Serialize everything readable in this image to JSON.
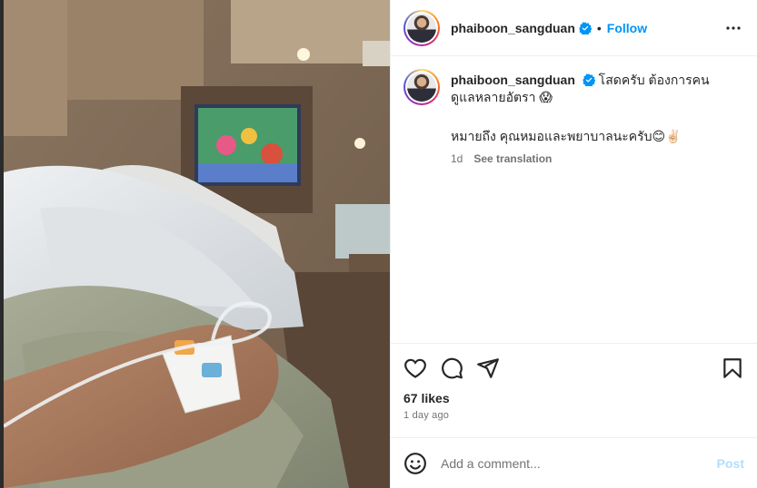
{
  "header": {
    "username": "phaiboon_sangduan",
    "separator": "•",
    "follow_label": "Follow",
    "more_icon": "more-horizontal-icon"
  },
  "caption": {
    "username": "phaiboon_sangduan",
    "line1": "โสดครับ ต้องการคนดูแลหลายอัตรา 😱",
    "line2": "หมายถึง คุณหมอและพยาบาลนะครับ😊✌🏻",
    "age": "1d",
    "see_translation": "See translation"
  },
  "actions": {
    "icons": [
      "heart-icon",
      "comment-icon",
      "share-icon",
      "bookmark-icon"
    ],
    "likes": "67 likes",
    "timestamp": "1 day ago"
  },
  "comment_box": {
    "placeholder": "Add a comment...",
    "post_label": "Post",
    "emoji_icon": "emoji-icon"
  },
  "colors": {
    "accent": "#0095f6",
    "post_disabled": "#b2dffc",
    "muted": "#737373",
    "text": "#262626"
  }
}
